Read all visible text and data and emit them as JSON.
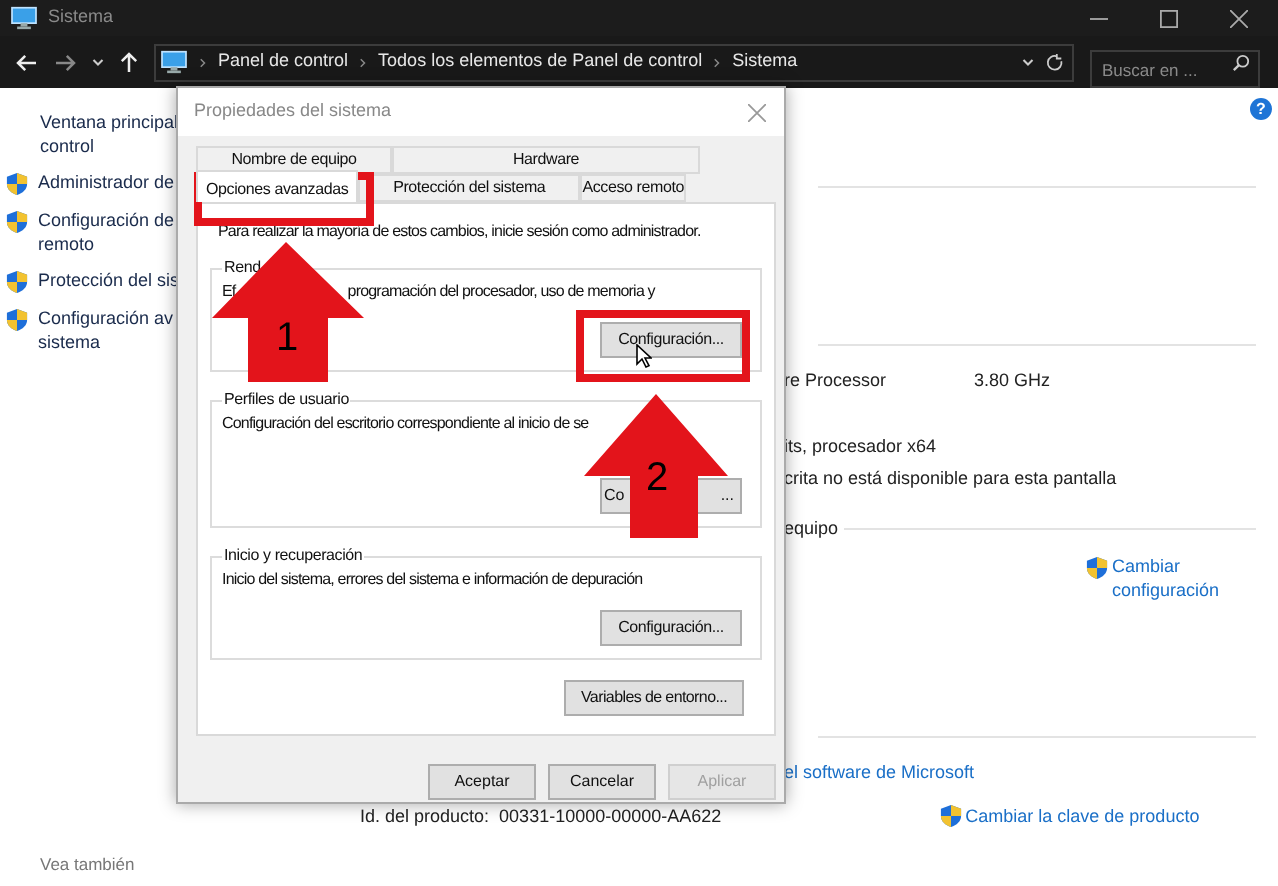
{
  "explorer": {
    "title": "Sistema",
    "address": [
      "Panel de control",
      "Todos los elementos de Panel de control",
      "Sistema"
    ],
    "search": {
      "placeholder": "Buscar en ..."
    },
    "sidebar": {
      "items": [
        {
          "lines": [
            "Ventana principal",
            "control"
          ],
          "shield": false
        },
        {
          "lines": [
            "Administrador de"
          ],
          "shield": true
        },
        {
          "lines": [
            "Configuración de",
            "remoto"
          ],
          "shield": true
        },
        {
          "lines": [
            "Protección del sis"
          ],
          "shield": true
        },
        {
          "lines": [
            "Configuración av",
            "sistema"
          ],
          "shield": true
        }
      ]
    },
    "content": {
      "processor": {
        "label": "re Processor",
        "value": "3.80 GHz"
      },
      "system_type": "its, procesador x64",
      "pen": "crita no está disponible para esta pantalla",
      "section": "equipo",
      "change_settings": [
        "Cambiar",
        "configuración"
      ],
      "license_link": "el software de Microsoft",
      "product_id": {
        "label": "Id. del producto:",
        "value": "00331-10000-00000-AA622"
      },
      "change_key": "Cambiar la clave de producto"
    },
    "see_also": "Vea también",
    "help": "?"
  },
  "dialog": {
    "title": "Propiedades del sistema",
    "tab_rows": [
      [
        {
          "label": "Nombre de equipo",
          "selected": false
        },
        {
          "label": "Hardware",
          "selected": false
        }
      ],
      [
        {
          "label": "Opciones avanzadas",
          "selected": true
        },
        {
          "label": "Protección del sistema",
          "selected": false
        },
        {
          "label": "Acceso remoto",
          "selected": false
        }
      ]
    ],
    "notice": "Para realizar la mayoría de estos cambios, inicie sesión como administrador.",
    "groups": [
      {
        "title": "Rend",
        "description": [
          "Ef",
          "programación del procesador, uso de memoria y"
        ],
        "button": [
          "Configuración..."
        ]
      },
      {
        "title": "Perfiles de usuario",
        "description": [
          "Configuración del escritorio correspondiente al inicio de se"
        ],
        "button": [
          "Co",
          "..."
        ]
      },
      {
        "title": "Inicio y recuperación",
        "description": [
          "Inicio del sistema, errores del sistema e información de depuración"
        ],
        "button": [
          "Configuración..."
        ]
      }
    ],
    "env_button": "Variables de entorno...",
    "buttons": [
      {
        "label": "Aceptar",
        "disabled": false
      },
      {
        "label": "Cancelar",
        "disabled": false
      },
      {
        "label": "Aplicar",
        "disabled": true
      }
    ]
  },
  "annotations": [
    {
      "label": "1"
    },
    {
      "label": "2"
    }
  ]
}
